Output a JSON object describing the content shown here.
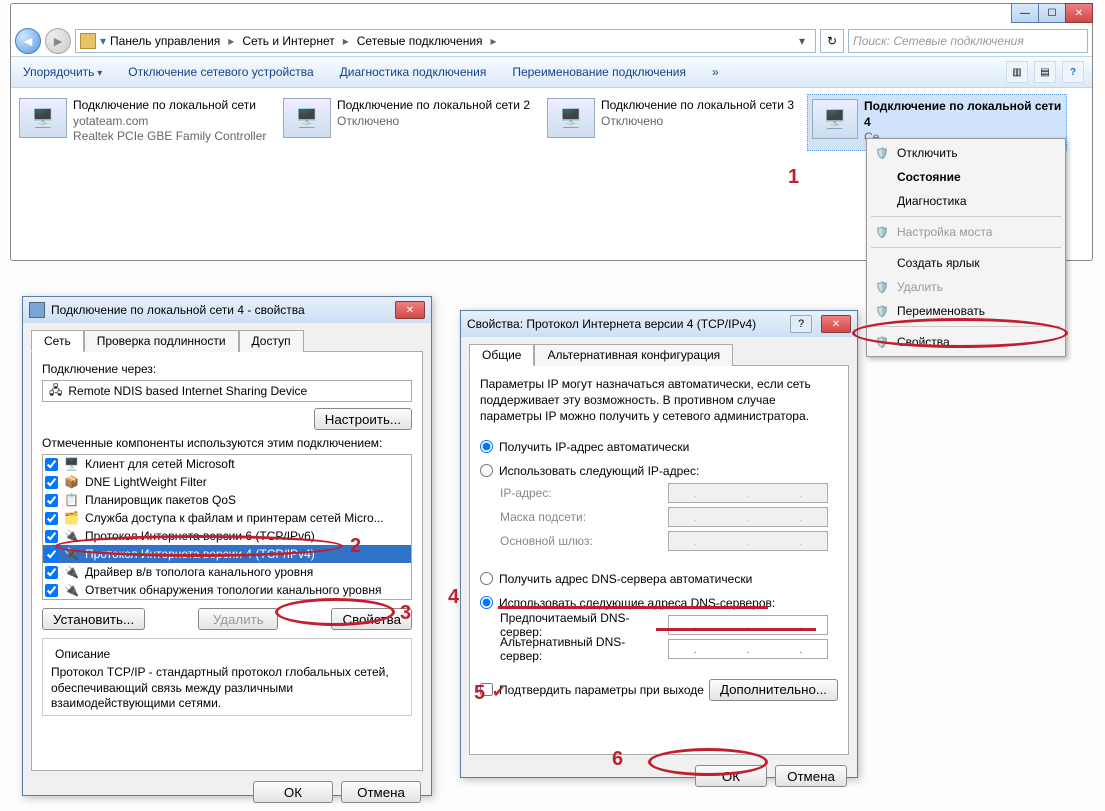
{
  "explorer": {
    "breadcrumb": {
      "p1": "Панель управления",
      "p2": "Сеть и Интернет",
      "p3": "Сетевые подключения"
    },
    "search_placeholder": "Поиск: Сетевые подключения",
    "toolbar": {
      "organize": "Упорядочить",
      "disable": "Отключение сетевого устройства",
      "diagnose": "Диагностика подключения",
      "rename": "Переименование подключения",
      "more": "»"
    },
    "connections": [
      {
        "name": "Подключение по локальной сети",
        "line2": "yotateam.com",
        "line3": "Realtek PCIe GBE Family Controller"
      },
      {
        "name": "Подключение по локальной сети 2",
        "line2": "Отключено",
        "line3": ""
      },
      {
        "name": "Подключение по локальной сети 3",
        "line2": "Отключено",
        "line3": ""
      },
      {
        "name": "Подключение по локальной сети 4",
        "line2": "Се",
        "line3": ""
      }
    ],
    "ctx": {
      "disable": "Отключить",
      "status": "Состояние",
      "diagnose": "Диагностика",
      "bridge": "Настройка моста",
      "shortcut": "Создать ярлык",
      "delete": "Удалить",
      "rename": "Переименовать",
      "properties": "Свойства"
    }
  },
  "dlg1": {
    "title": "Подключение по локальной сети 4 - свойства",
    "tabs": {
      "net": "Сеть",
      "auth": "Проверка подлинности",
      "access": "Доступ"
    },
    "connect_via_label": "Подключение через:",
    "adapter": "Remote NDIS based Internet Sharing Device",
    "configure": "Настроить...",
    "components_label": "Отмеченные компоненты используются этим подключением:",
    "components": [
      "Клиент для сетей Microsoft",
      "DNE LightWeight Filter",
      "Планировщик пакетов QoS",
      "Служба доступа к файлам и принтерам сетей Micro...",
      "Протокол Интернета версии 6 (TCP/IPv6)",
      "Протокол Интернета версии 4 (TCP/IPv4)",
      "Драйвер в/в тополога канального уровня",
      "Ответчик обнаружения топологии канального уровня"
    ],
    "install": "Установить...",
    "remove": "Удалить",
    "properties": "Свойства",
    "desc_title": "Описание",
    "desc_text": "Протокол TCP/IP - стандартный протокол глобальных сетей, обеспечивающий связь между различными взаимодействующими сетями.",
    "ok": "ОК",
    "cancel": "Отмена"
  },
  "dlg2": {
    "title": "Свойства: Протокол Интернета версии 4 (TCP/IPv4)",
    "tabs": {
      "general": "Общие",
      "alt": "Альтернативная конфигурация"
    },
    "intro": "Параметры IP могут назначаться автоматически, если сеть поддерживает эту возможность. В противном случае параметры IP можно получить у сетевого администратора.",
    "radio_ip_auto": "Получить IP-адрес автоматически",
    "radio_ip_manual": "Использовать следующий IP-адрес:",
    "ip_label": "IP-адрес:",
    "mask_label": "Маска подсети:",
    "gw_label": "Основной шлюз:",
    "radio_dns_auto": "Получить адрес DNS-сервера автоматически",
    "radio_dns_manual": "Использовать следующие адреса DNS-серверов:",
    "dns1": "Предпочитаемый DNS-сервер:",
    "dns2": "Альтернативный DNS-сервер:",
    "validate": "Подтвердить параметры при выходе",
    "advanced": "Дополнительно...",
    "ok": "ОК",
    "cancel": "Отмена"
  },
  "annotations": {
    "n1": "1",
    "n2": "2",
    "n3": "3",
    "n4": "4",
    "n5": "5",
    "n6": "6"
  }
}
